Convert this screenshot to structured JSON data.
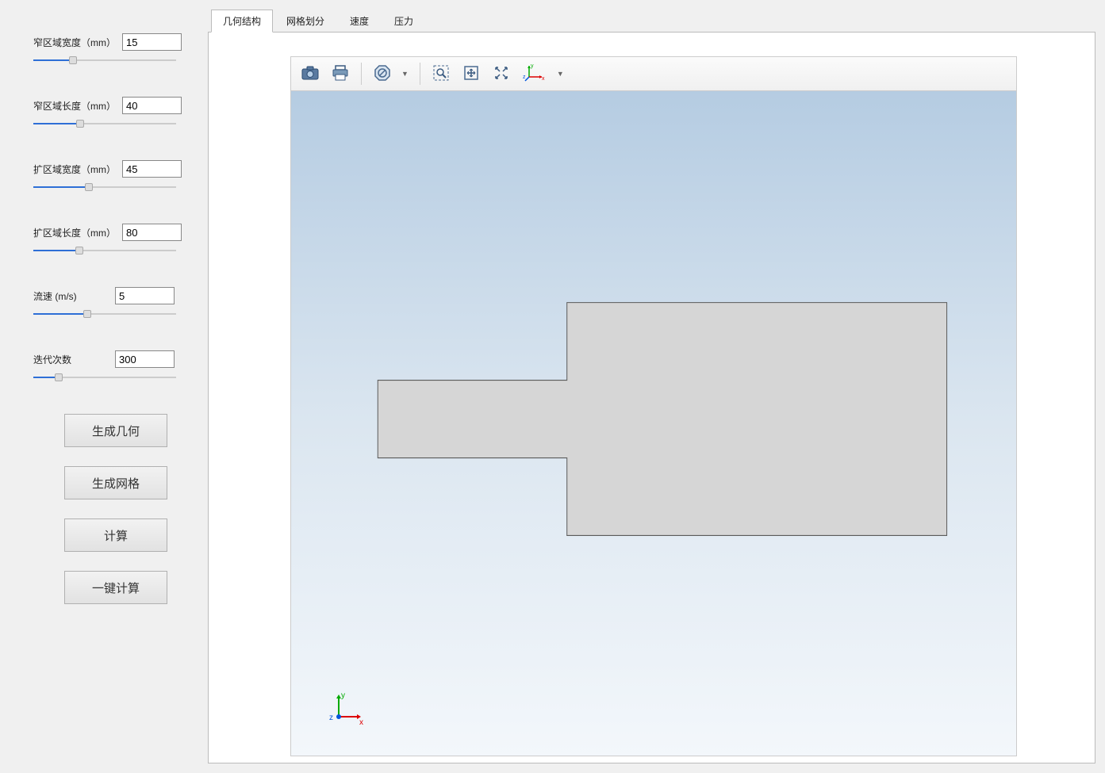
{
  "sidebar": {
    "params": [
      {
        "label": "窄区域宽度（mm）",
        "value": "15",
        "sliderPct": 28
      },
      {
        "label": "窄区域长度（mm）",
        "value": "40",
        "sliderPct": 33
      },
      {
        "label": "扩区域宽度（mm）",
        "value": "45",
        "sliderPct": 39
      },
      {
        "label": "扩区域长度（mm）",
        "value": "80",
        "sliderPct": 32
      },
      {
        "label": "流速 (m/s)",
        "value": "5",
        "sliderPct": 38
      },
      {
        "label": "迭代次数",
        "value": "300",
        "sliderPct": 18
      }
    ],
    "buttons": {
      "generate_geometry": "生成几何",
      "generate_mesh": "生成网格",
      "compute": "计算",
      "one_click_compute": "一键计算"
    }
  },
  "tabs": [
    {
      "label": "几何结构",
      "active": true
    },
    {
      "label": "网格划分",
      "active": false
    },
    {
      "label": "速度",
      "active": false
    },
    {
      "label": "压力",
      "active": false
    }
  ],
  "toolbar": {
    "icons": [
      "camera-icon",
      "print-icon",
      "sep",
      "no-entry-icon",
      "caret",
      "sep",
      "zoom-select-icon",
      "fit-icon",
      "center-icon",
      "axis-triad-icon",
      "caret"
    ]
  },
  "viewport": {
    "axis_labels": {
      "x": "x",
      "y": "y",
      "z": "z"
    }
  }
}
